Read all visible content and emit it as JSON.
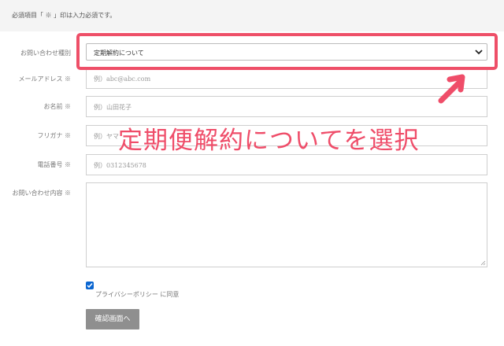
{
  "notice": "必須項目「 ※ 」印は入力必須です。",
  "form": {
    "inquiry_type": {
      "label": "お問い合わせ種別",
      "value": "定期解約について"
    },
    "email": {
      "label": "メールアドレス ※",
      "placeholder": "例）abc@abc.com"
    },
    "name": {
      "label": "お名前 ※",
      "placeholder": "例）山田花子"
    },
    "furigana": {
      "label": "フリガナ ※",
      "placeholder": "例）ヤマ"
    },
    "phone": {
      "label": "電話番号 ※",
      "placeholder": "例）0312345678"
    },
    "message": {
      "label": "お問い合わせ内容 ※"
    },
    "privacy": {
      "label": "プライバシーポリシー に同意",
      "checked": true
    },
    "submit_label": "確認画面へ"
  },
  "annotation": {
    "text": "定期便解約についてを選択",
    "color": "#ef4d69"
  },
  "icons": {
    "select": "chevron-down-icon",
    "arrow": "arrow-up-right-icon",
    "checkbox": "check-icon"
  }
}
